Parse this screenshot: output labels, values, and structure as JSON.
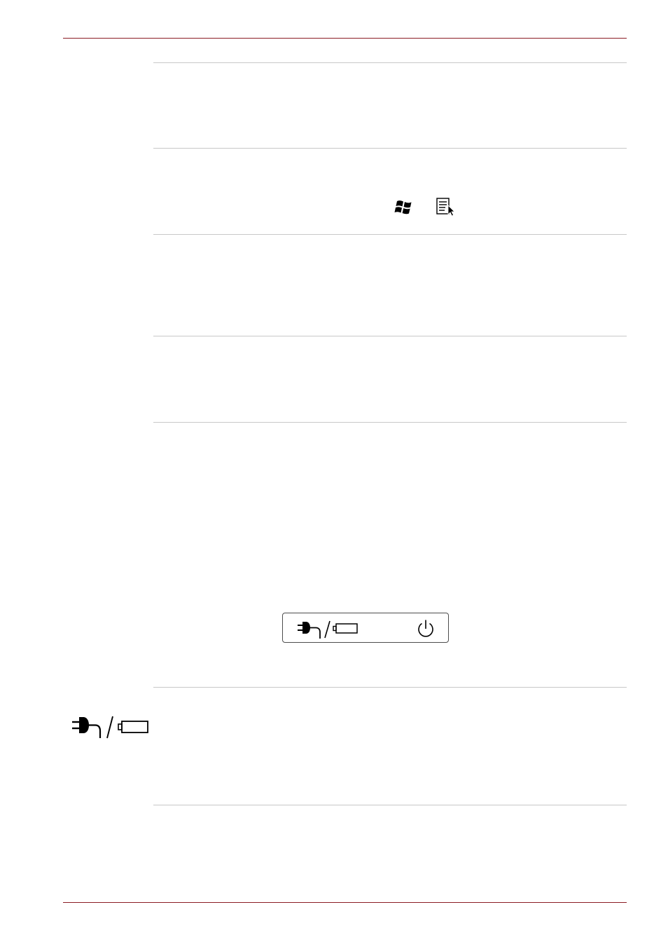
{
  "page": {
    "header_rule_color": "#8b1c24",
    "separator_color": "#c8c8c8"
  },
  "rows": [
    {
      "id": "row-1"
    },
    {
      "id": "row-2",
      "inline_icons": [
        "windows-logo-icon",
        "application-menu-icon"
      ]
    },
    {
      "id": "row-3"
    },
    {
      "id": "row-4"
    },
    {
      "id": "row-5",
      "figure": {
        "icons": [
          "dc-in-battery-icon",
          "power-icon"
        ]
      }
    },
    {
      "id": "row-6",
      "side_icon": "dc-in-battery-icon"
    },
    {
      "id": "row-7"
    }
  ]
}
